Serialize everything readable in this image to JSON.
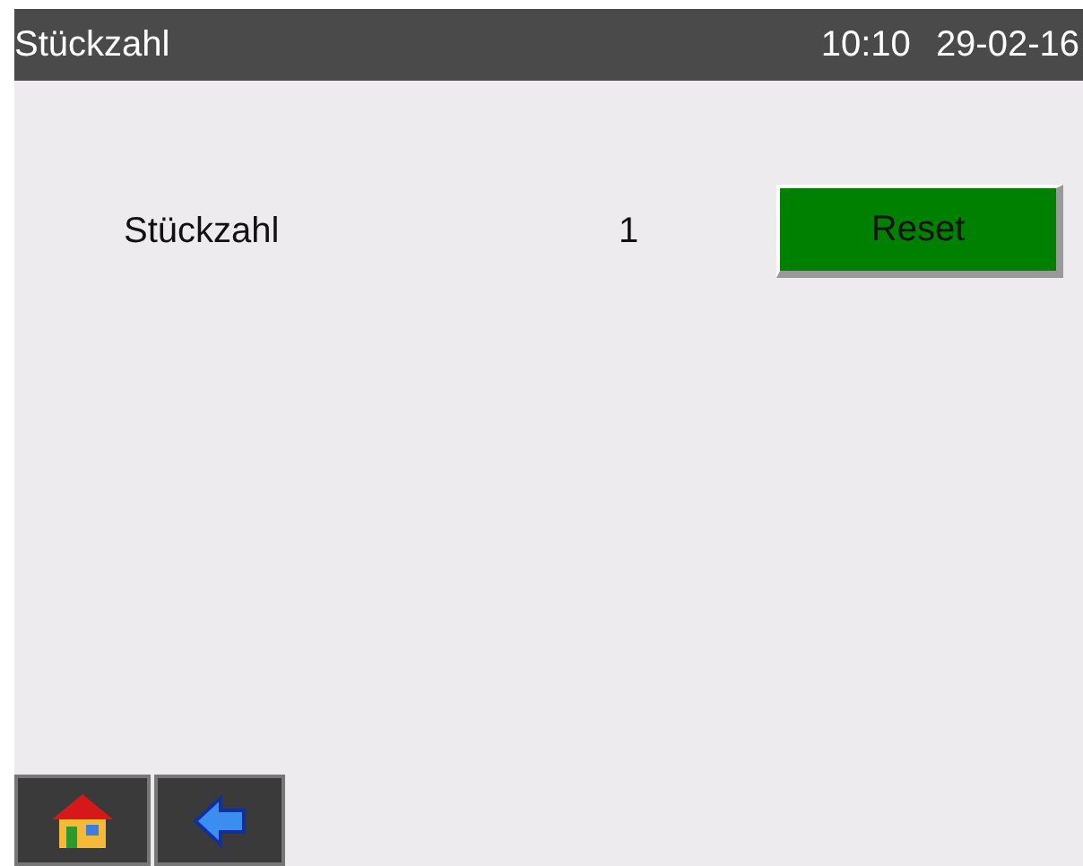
{
  "header": {
    "title": "Stückzahl",
    "time": "10:10",
    "date": "29-02-16"
  },
  "counter": {
    "label": "Stückzahl",
    "value": "1",
    "button": "Reset"
  }
}
